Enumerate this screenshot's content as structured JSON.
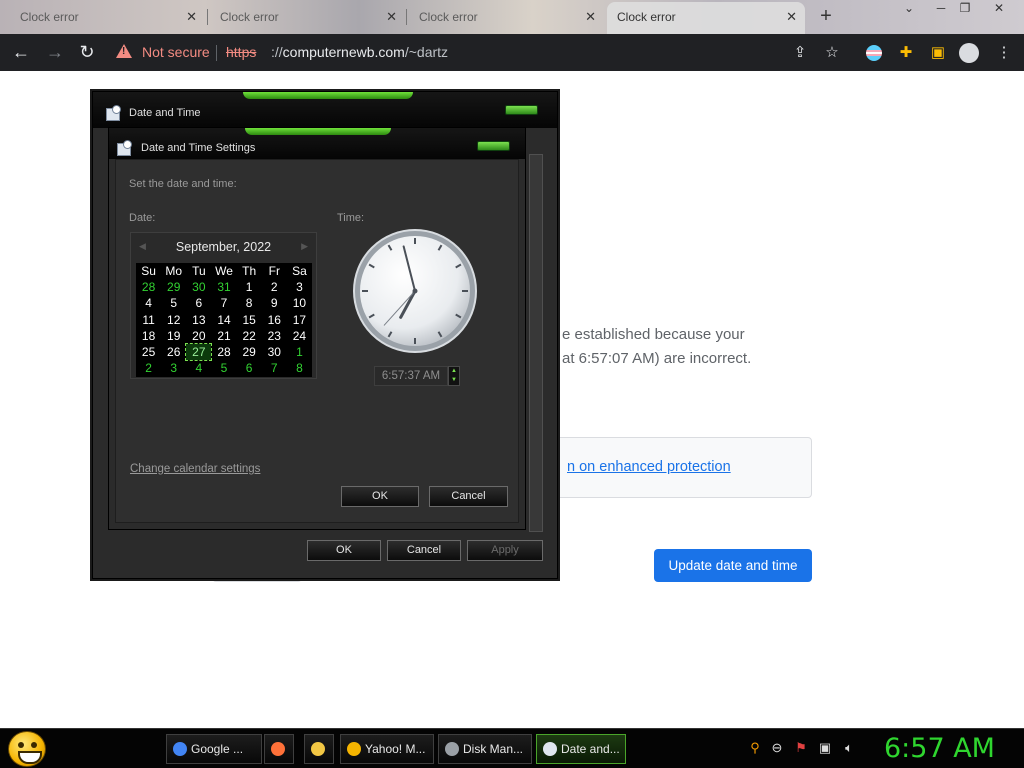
{
  "browser": {
    "tabs": [
      {
        "title": "Clock error",
        "active": false
      },
      {
        "title": "Clock error",
        "active": false
      },
      {
        "title": "Clock error",
        "active": false
      },
      {
        "title": "Clock error",
        "active": true
      }
    ],
    "security_label": "Not secure",
    "url_scheme": "https",
    "url_host": "computernewb.com",
    "url_path": "/~dartz"
  },
  "page": {
    "error_line1": "e established because your",
    "error_line2": "at 6:57:07 AM) are incorrect.",
    "protection_link": "n on enhanced protection",
    "update_button": "Update date and time"
  },
  "outer_dialog": {
    "title": "Date and Time",
    "ok": "OK",
    "cancel": "Cancel",
    "apply": "Apply"
  },
  "inner_dialog": {
    "title": "Date and Time Settings",
    "instruction": "Set the date and time:",
    "date_label": "Date:",
    "time_label": "Time:",
    "calendar": {
      "month_label": "September, 2022",
      "weekdays": [
        "Su",
        "Mo",
        "Tu",
        "We",
        "Th",
        "Fr",
        "Sa"
      ],
      "weeks": [
        [
          [
            "28",
            1
          ],
          [
            "29",
            1
          ],
          [
            "30",
            1
          ],
          [
            "31",
            1
          ],
          [
            "1",
            0
          ],
          [
            "2",
            0
          ],
          [
            "3",
            0
          ]
        ],
        [
          [
            "4",
            0
          ],
          [
            "5",
            0
          ],
          [
            "6",
            0
          ],
          [
            "7",
            0
          ],
          [
            "8",
            0
          ],
          [
            "9",
            0
          ],
          [
            "10",
            0
          ]
        ],
        [
          [
            "11",
            0
          ],
          [
            "12",
            0
          ],
          [
            "13",
            0
          ],
          [
            "14",
            0
          ],
          [
            "15",
            0
          ],
          [
            "16",
            0
          ],
          [
            "17",
            0
          ]
        ],
        [
          [
            "18",
            0
          ],
          [
            "19",
            0
          ],
          [
            "20",
            0
          ],
          [
            "21",
            0
          ],
          [
            "22",
            0
          ],
          [
            "23",
            0
          ],
          [
            "24",
            0
          ]
        ],
        [
          [
            "25",
            0
          ],
          [
            "26",
            0
          ],
          [
            "27",
            2
          ],
          [
            "28",
            0
          ],
          [
            "29",
            0
          ],
          [
            "30",
            0
          ],
          [
            "1",
            1
          ]
        ],
        [
          [
            "2",
            1
          ],
          [
            "3",
            1
          ],
          [
            "4",
            1
          ],
          [
            "5",
            1
          ],
          [
            "6",
            1
          ],
          [
            "7",
            1
          ],
          [
            "8",
            1
          ]
        ]
      ]
    },
    "clock": {
      "hour": 6,
      "minute": 57,
      "second": 37
    },
    "time_value": "6:57:37 AM",
    "change_calendar_link": "Change calendar settings",
    "ok": "OK",
    "cancel": "Cancel"
  },
  "taskbar": {
    "items": [
      {
        "label": "Google ...",
        "icon": "chrome-icon",
        "color": "#4285f4",
        "active": false
      },
      {
        "label": "",
        "icon": "firefox-icon",
        "color": "#ff7139",
        "active": false
      },
      {
        "label": "",
        "icon": "folder-icon",
        "color": "#f2c744",
        "active": false
      },
      {
        "label": "Yahoo! M...",
        "icon": "yahoo-messenger-icon",
        "color": "#f5b400",
        "active": false
      },
      {
        "label": "Disk Man...",
        "icon": "disk-management-icon",
        "color": "#9aa0a6",
        "active": false
      },
      {
        "label": "Date and...",
        "icon": "date-time-icon",
        "color": "#dfe6ef",
        "active": true
      }
    ],
    "tray_time": "6:57 AM"
  },
  "colors": {
    "accent_green": "#2fd62f",
    "chrome_blue": "#1a73e8",
    "warning_red": "#f28b82"
  }
}
